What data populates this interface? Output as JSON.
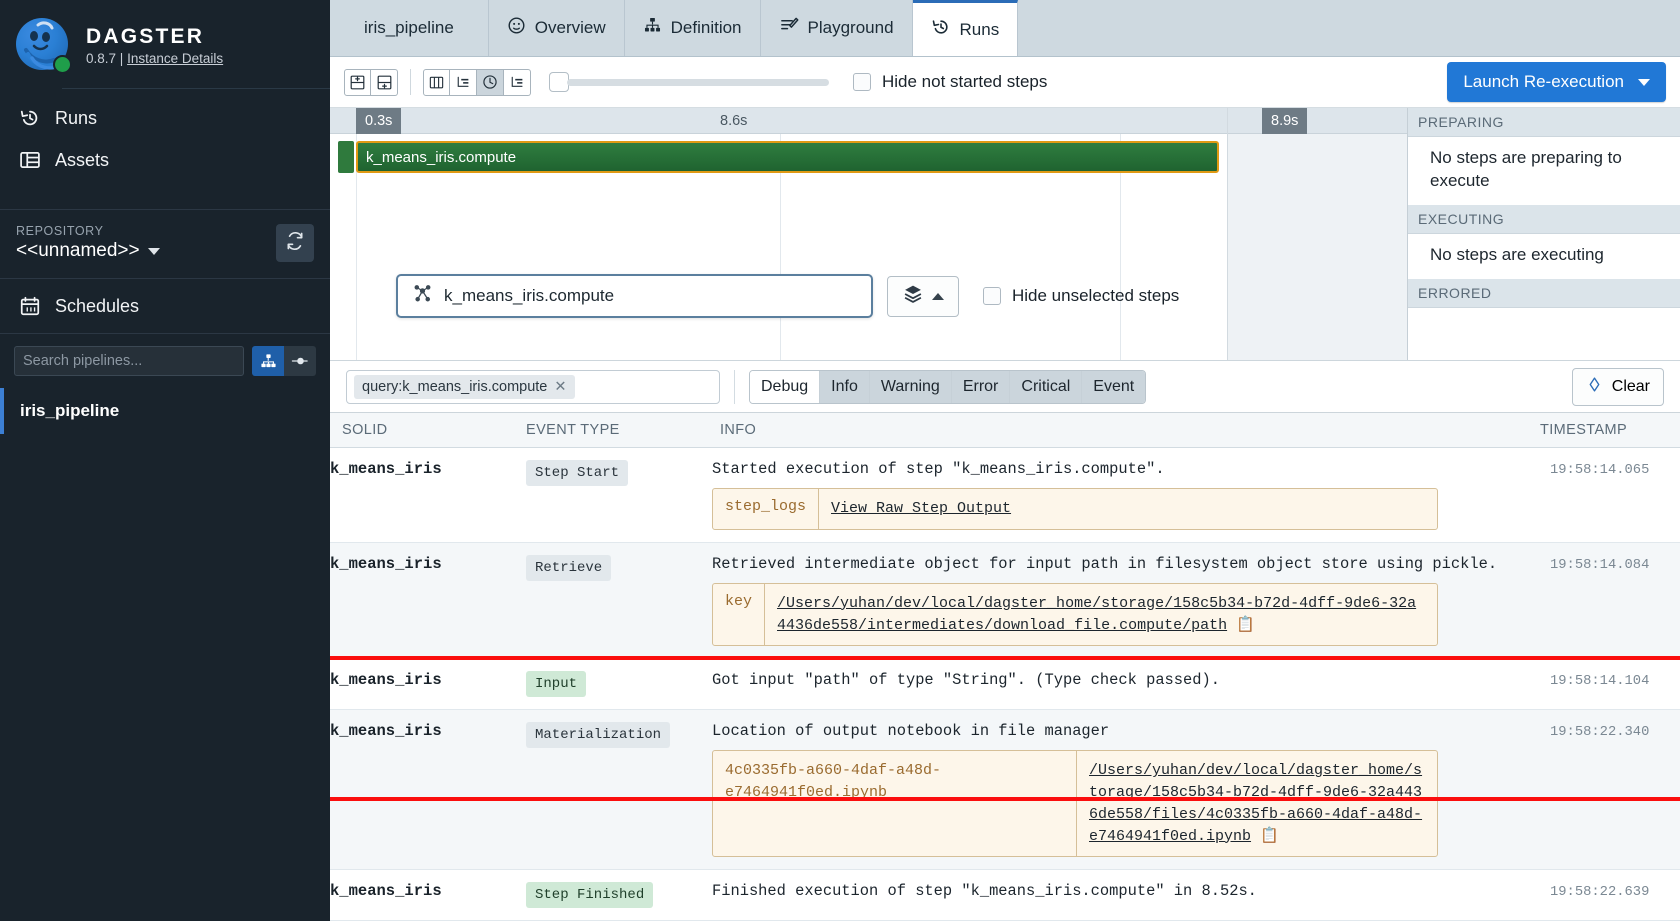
{
  "sidebar": {
    "brand": {
      "name": "DAGSTER",
      "version": "0.8.7",
      "separator": "|",
      "instance_link": "Instance Details",
      "status_color": "#1f9e4a"
    },
    "nav": [
      {
        "label": "Runs",
        "icon": "history-clock-icon"
      },
      {
        "label": "Assets",
        "icon": "table-grid-icon"
      }
    ],
    "repository": {
      "label": "REPOSITORY",
      "name": "<<unnamed>>",
      "reload_icon": "refresh-icon"
    },
    "schedules": {
      "label": "Schedules",
      "icon": "calendar-icon"
    },
    "search": {
      "placeholder": "Search pipelines...",
      "value": "",
      "view_graph_icon": "hierarchy-icon",
      "view_flat_icon": "solid-node-icon"
    },
    "pipelines": [
      {
        "label": "iris_pipeline",
        "selected": true
      }
    ]
  },
  "tabs": [
    {
      "label": "iris_pipeline",
      "icon": "",
      "active": false,
      "is_title": true
    },
    {
      "label": "Overview",
      "icon": "speedometer-icon",
      "active": false
    },
    {
      "label": "Definition",
      "icon": "hierarchy-icon",
      "active": false
    },
    {
      "label": "Playground",
      "icon": "playground-icon",
      "active": false
    },
    {
      "label": "Runs",
      "icon": "history-clock-icon",
      "active": true
    }
  ],
  "toolbar": {
    "zoom_in_icon": "zoom-in-icon",
    "zoom_out_icon": "zoom-out-icon",
    "view_columns_icon": "columns-icon",
    "view_waterfall_icon": "waterfall-icon",
    "view_time_icon": "clock-icon",
    "view_steps_icon": "steps-icon",
    "zoom_slider_value": 0,
    "hide_not_started_label": "Hide not started steps",
    "hide_not_started_checked": false,
    "launch_button_label": "Launch Re-execution",
    "launch_button_color": "#2178d6"
  },
  "gantt": {
    "ruler": {
      "start_label": "0.3s",
      "mid_label": "8.6s",
      "end_label": "8.9s"
    },
    "bars": [
      {
        "label": "k_means_iris.compute",
        "color": "#2f7d3f",
        "selected_outline": "#e09a14"
      }
    ],
    "selector": {
      "value": "k_means_iris.compute",
      "icon": "solid-graph-icon",
      "layers_icon": "layers-icon"
    },
    "hide_unselected_label": "Hide unselected steps",
    "hide_unselected_checked": false,
    "sections": [
      {
        "title": "PREPARING",
        "body": "No steps are preparing to execute"
      },
      {
        "title": "EXECUTING",
        "body": "No steps are executing"
      },
      {
        "title": "ERRORED",
        "body": ""
      }
    ]
  },
  "filterbar": {
    "token": "query:k_means_iris.compute",
    "token_remove_icon": "close-icon",
    "levels": [
      {
        "label": "Debug",
        "active": false
      },
      {
        "label": "Info",
        "active": true
      },
      {
        "label": "Warning",
        "active": true
      },
      {
        "label": "Error",
        "active": true
      },
      {
        "label": "Critical",
        "active": true
      },
      {
        "label": "Event",
        "active": true
      }
    ],
    "clear_label": "Clear",
    "clear_icon": "eraser-icon"
  },
  "log_table": {
    "columns": [
      "SOLID",
      "EVENT TYPE",
      "INFO",
      "TIMESTAMP"
    ],
    "rows": [
      {
        "solid": "k_means_iris",
        "event_type": "Step Start",
        "event_style": "grey",
        "info": "Started execution of step \"k_means_iris.compute\".",
        "meta": {
          "key": "step_logs",
          "value": "View Raw Step Output",
          "is_link": true,
          "copy_icon": false
        },
        "timestamp": "19:58:14.065",
        "highlighted": false
      },
      {
        "solid": "k_means_iris",
        "event_type": "Retrieve",
        "event_style": "grey",
        "info": "Retrieved intermediate object for input path in filesystem object store using pickle.",
        "meta": {
          "key": "key",
          "value": "/Users/yuhan/dev/local/dagster_home/storage/158c5b34-b72d-4dff-9de6-32a4436de558/intermediates/download_file.compute/path",
          "is_link": true,
          "copy_icon": true
        },
        "timestamp": "19:58:14.084",
        "highlighted": false
      },
      {
        "solid": "k_means_iris",
        "event_type": "Input",
        "event_style": "green",
        "info": "Got input \"path\" of type \"String\". (Type check passed).",
        "meta": null,
        "timestamp": "19:58:14.104",
        "highlighted": false
      },
      {
        "solid": "k_means_iris",
        "event_type": "Materialization",
        "event_style": "grey",
        "info": "Location of output notebook in file manager",
        "meta": {
          "key": "4c0335fb-a660-4daf-a48d-e7464941f0ed.ipynb",
          "value": "/Users/yuhan/dev/local/dagster_home/storage/158c5b34-b72d-4dff-9de6-32a4436de558/files/4c0335fb-a660-4daf-a48d-e7464941f0ed.ipynb",
          "is_link": true,
          "copy_icon": true
        },
        "timestamp": "19:58:22.340",
        "highlighted": true
      },
      {
        "solid": "k_means_iris",
        "event_type": "Step Finished",
        "event_style": "green",
        "info": "Finished execution of step \"k_means_iris.compute\" in 8.52s.",
        "meta": null,
        "timestamp": "19:58:22.639",
        "highlighted": false
      }
    ],
    "highlight_color": "#fb0e0e"
  }
}
